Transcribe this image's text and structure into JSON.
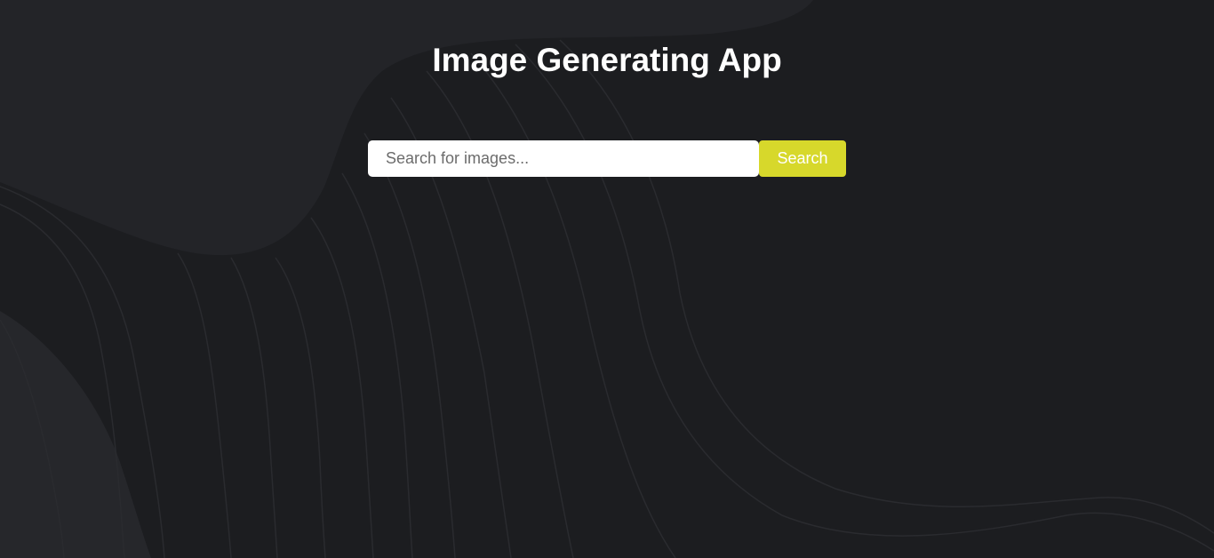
{
  "header": {
    "title": "Image Generating App"
  },
  "search": {
    "placeholder": "Search for images...",
    "value": "",
    "button_label": "Search"
  },
  "colors": {
    "background": "#1c1d20",
    "accent": "#d7d82b",
    "title_text": "#ffffff"
  }
}
